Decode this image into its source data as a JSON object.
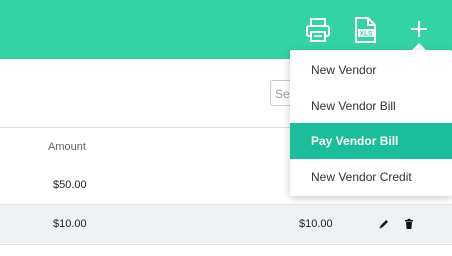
{
  "toolbar": {
    "icons": [
      "printer-icon",
      "xls-export-icon",
      "plus-icon"
    ],
    "xls_label": "XLS",
    "accent_color": "#34d3a6"
  },
  "search": {
    "placeholder": "Search"
  },
  "table": {
    "columns": [
      "Amount"
    ],
    "rows": [
      {
        "amount": "$50.00",
        "amount2": ""
      },
      {
        "amount": "$10.00",
        "amount2": "$10.00"
      }
    ]
  },
  "menu": {
    "items": [
      {
        "label": "New Vendor"
      },
      {
        "label": "New Vendor Bill"
      },
      {
        "label": "Pay Vendor Bill",
        "active": true
      },
      {
        "label": "New Vendor Credit"
      }
    ],
    "active_color": "#1bbd9a"
  }
}
